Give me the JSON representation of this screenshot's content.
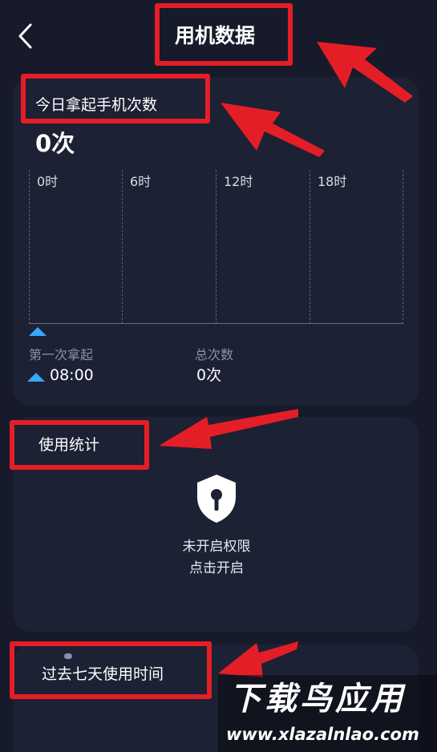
{
  "header": {
    "title": "用机数据"
  },
  "pickup_card": {
    "title": "今日拿起手机次数",
    "count": "0次",
    "hours": [
      "0时",
      "6时",
      "12时",
      "18时"
    ],
    "first_pickup_label": "第一次拿起",
    "first_pickup_time": "08:00",
    "total_label": "总次数",
    "total_value": "0次"
  },
  "usage_card": {
    "title": "使用统计",
    "permission_line1": "未开启权限",
    "permission_line2": "点击开启"
  },
  "week_card": {
    "title": "过去七天使用时间"
  },
  "watermark": {
    "main": "下载鸟应用",
    "url": "www.xlazalnlao.com"
  },
  "colors": {
    "background": "#161a2a",
    "card": "#1c2133",
    "accent": "#39a8ff",
    "annotation": "#e41e26"
  }
}
